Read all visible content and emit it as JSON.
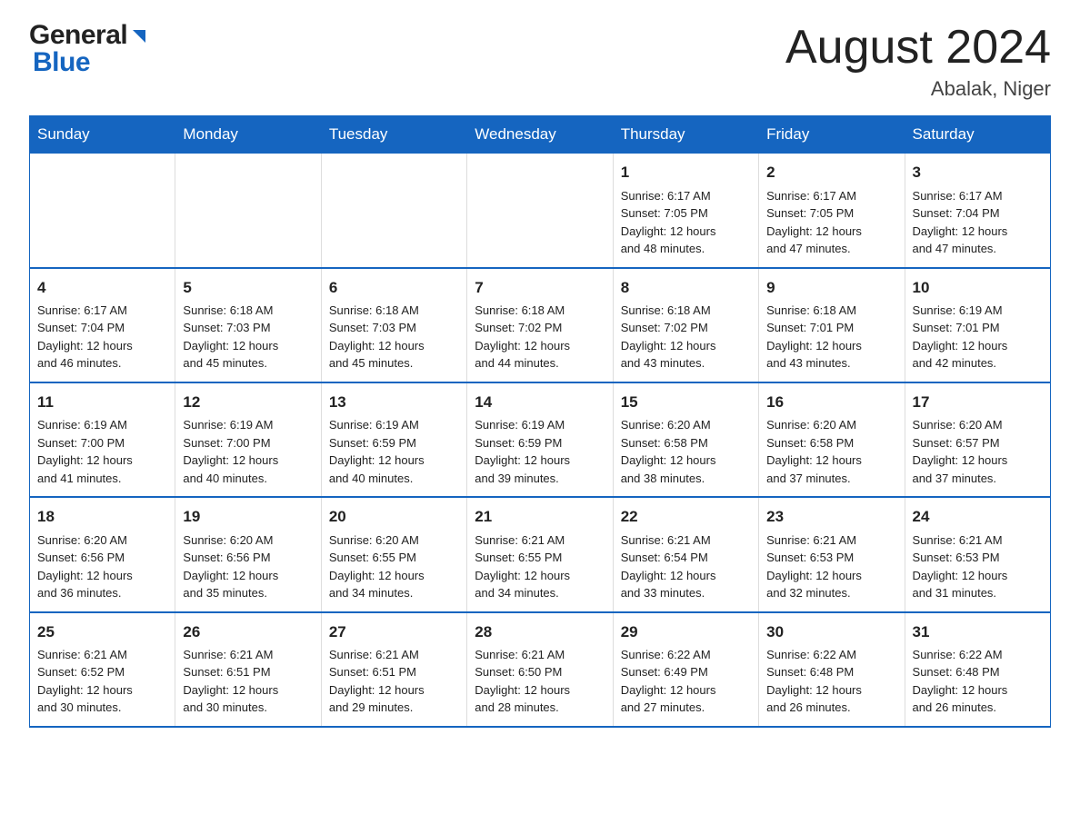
{
  "logo": {
    "general": "General",
    "triangle": "▶",
    "blue": "Blue"
  },
  "title": "August 2024",
  "location": "Abalak, Niger",
  "weekdays": [
    "Sunday",
    "Monday",
    "Tuesday",
    "Wednesday",
    "Thursday",
    "Friday",
    "Saturday"
  ],
  "weeks": [
    [
      {
        "day": "",
        "info": ""
      },
      {
        "day": "",
        "info": ""
      },
      {
        "day": "",
        "info": ""
      },
      {
        "day": "",
        "info": ""
      },
      {
        "day": "1",
        "info": "Sunrise: 6:17 AM\nSunset: 7:05 PM\nDaylight: 12 hours\nand 48 minutes."
      },
      {
        "day": "2",
        "info": "Sunrise: 6:17 AM\nSunset: 7:05 PM\nDaylight: 12 hours\nand 47 minutes."
      },
      {
        "day": "3",
        "info": "Sunrise: 6:17 AM\nSunset: 7:04 PM\nDaylight: 12 hours\nand 47 minutes."
      }
    ],
    [
      {
        "day": "4",
        "info": "Sunrise: 6:17 AM\nSunset: 7:04 PM\nDaylight: 12 hours\nand 46 minutes."
      },
      {
        "day": "5",
        "info": "Sunrise: 6:18 AM\nSunset: 7:03 PM\nDaylight: 12 hours\nand 45 minutes."
      },
      {
        "day": "6",
        "info": "Sunrise: 6:18 AM\nSunset: 7:03 PM\nDaylight: 12 hours\nand 45 minutes."
      },
      {
        "day": "7",
        "info": "Sunrise: 6:18 AM\nSunset: 7:02 PM\nDaylight: 12 hours\nand 44 minutes."
      },
      {
        "day": "8",
        "info": "Sunrise: 6:18 AM\nSunset: 7:02 PM\nDaylight: 12 hours\nand 43 minutes."
      },
      {
        "day": "9",
        "info": "Sunrise: 6:18 AM\nSunset: 7:01 PM\nDaylight: 12 hours\nand 43 minutes."
      },
      {
        "day": "10",
        "info": "Sunrise: 6:19 AM\nSunset: 7:01 PM\nDaylight: 12 hours\nand 42 minutes."
      }
    ],
    [
      {
        "day": "11",
        "info": "Sunrise: 6:19 AM\nSunset: 7:00 PM\nDaylight: 12 hours\nand 41 minutes."
      },
      {
        "day": "12",
        "info": "Sunrise: 6:19 AM\nSunset: 7:00 PM\nDaylight: 12 hours\nand 40 minutes."
      },
      {
        "day": "13",
        "info": "Sunrise: 6:19 AM\nSunset: 6:59 PM\nDaylight: 12 hours\nand 40 minutes."
      },
      {
        "day": "14",
        "info": "Sunrise: 6:19 AM\nSunset: 6:59 PM\nDaylight: 12 hours\nand 39 minutes."
      },
      {
        "day": "15",
        "info": "Sunrise: 6:20 AM\nSunset: 6:58 PM\nDaylight: 12 hours\nand 38 minutes."
      },
      {
        "day": "16",
        "info": "Sunrise: 6:20 AM\nSunset: 6:58 PM\nDaylight: 12 hours\nand 37 minutes."
      },
      {
        "day": "17",
        "info": "Sunrise: 6:20 AM\nSunset: 6:57 PM\nDaylight: 12 hours\nand 37 minutes."
      }
    ],
    [
      {
        "day": "18",
        "info": "Sunrise: 6:20 AM\nSunset: 6:56 PM\nDaylight: 12 hours\nand 36 minutes."
      },
      {
        "day": "19",
        "info": "Sunrise: 6:20 AM\nSunset: 6:56 PM\nDaylight: 12 hours\nand 35 minutes."
      },
      {
        "day": "20",
        "info": "Sunrise: 6:20 AM\nSunset: 6:55 PM\nDaylight: 12 hours\nand 34 minutes."
      },
      {
        "day": "21",
        "info": "Sunrise: 6:21 AM\nSunset: 6:55 PM\nDaylight: 12 hours\nand 34 minutes."
      },
      {
        "day": "22",
        "info": "Sunrise: 6:21 AM\nSunset: 6:54 PM\nDaylight: 12 hours\nand 33 minutes."
      },
      {
        "day": "23",
        "info": "Sunrise: 6:21 AM\nSunset: 6:53 PM\nDaylight: 12 hours\nand 32 minutes."
      },
      {
        "day": "24",
        "info": "Sunrise: 6:21 AM\nSunset: 6:53 PM\nDaylight: 12 hours\nand 31 minutes."
      }
    ],
    [
      {
        "day": "25",
        "info": "Sunrise: 6:21 AM\nSunset: 6:52 PM\nDaylight: 12 hours\nand 30 minutes."
      },
      {
        "day": "26",
        "info": "Sunrise: 6:21 AM\nSunset: 6:51 PM\nDaylight: 12 hours\nand 30 minutes."
      },
      {
        "day": "27",
        "info": "Sunrise: 6:21 AM\nSunset: 6:51 PM\nDaylight: 12 hours\nand 29 minutes."
      },
      {
        "day": "28",
        "info": "Sunrise: 6:21 AM\nSunset: 6:50 PM\nDaylight: 12 hours\nand 28 minutes."
      },
      {
        "day": "29",
        "info": "Sunrise: 6:22 AM\nSunset: 6:49 PM\nDaylight: 12 hours\nand 27 minutes."
      },
      {
        "day": "30",
        "info": "Sunrise: 6:22 AM\nSunset: 6:48 PM\nDaylight: 12 hours\nand 26 minutes."
      },
      {
        "day": "31",
        "info": "Sunrise: 6:22 AM\nSunset: 6:48 PM\nDaylight: 12 hours\nand 26 minutes."
      }
    ]
  ]
}
